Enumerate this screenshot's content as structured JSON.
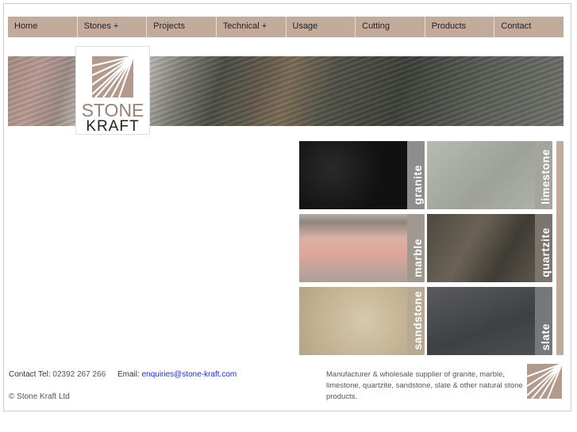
{
  "nav": {
    "items": [
      {
        "label": "Home"
      },
      {
        "label": "Stones +"
      },
      {
        "label": "Projects"
      },
      {
        "label": "Technical +"
      },
      {
        "label": "Usage"
      },
      {
        "label": "Cutting"
      },
      {
        "label": "Products"
      },
      {
        "label": "Contact"
      }
    ]
  },
  "logo": {
    "line1": "STONE",
    "line2": "KRAFT"
  },
  "tiles": [
    {
      "label": "granite",
      "color": "#151515"
    },
    {
      "label": "limestone",
      "color": "#a8aba2"
    },
    {
      "label": "marble",
      "color": "#cfa79c"
    },
    {
      "label": "quartzite",
      "color": "#5a564c"
    },
    {
      "label": "sandstone",
      "color": "#c9b99d"
    },
    {
      "label": "slate",
      "color": "#4a4c4f"
    }
  ],
  "footer": {
    "tel_label": "Contact Tel:",
    "tel_value": "02392 267 266",
    "email_label": "Email:",
    "email_value": "enquiries@stone-kraft.com",
    "copyright": "© Stone Kraft Ltd",
    "description": "Manufacturer & wholesale supplier of granite, marble, limestone, quartzite, sandstone, slate & other natural stone products."
  },
  "colors": {
    "accent": "#c3ab9c",
    "link": "#1a2ee0"
  }
}
